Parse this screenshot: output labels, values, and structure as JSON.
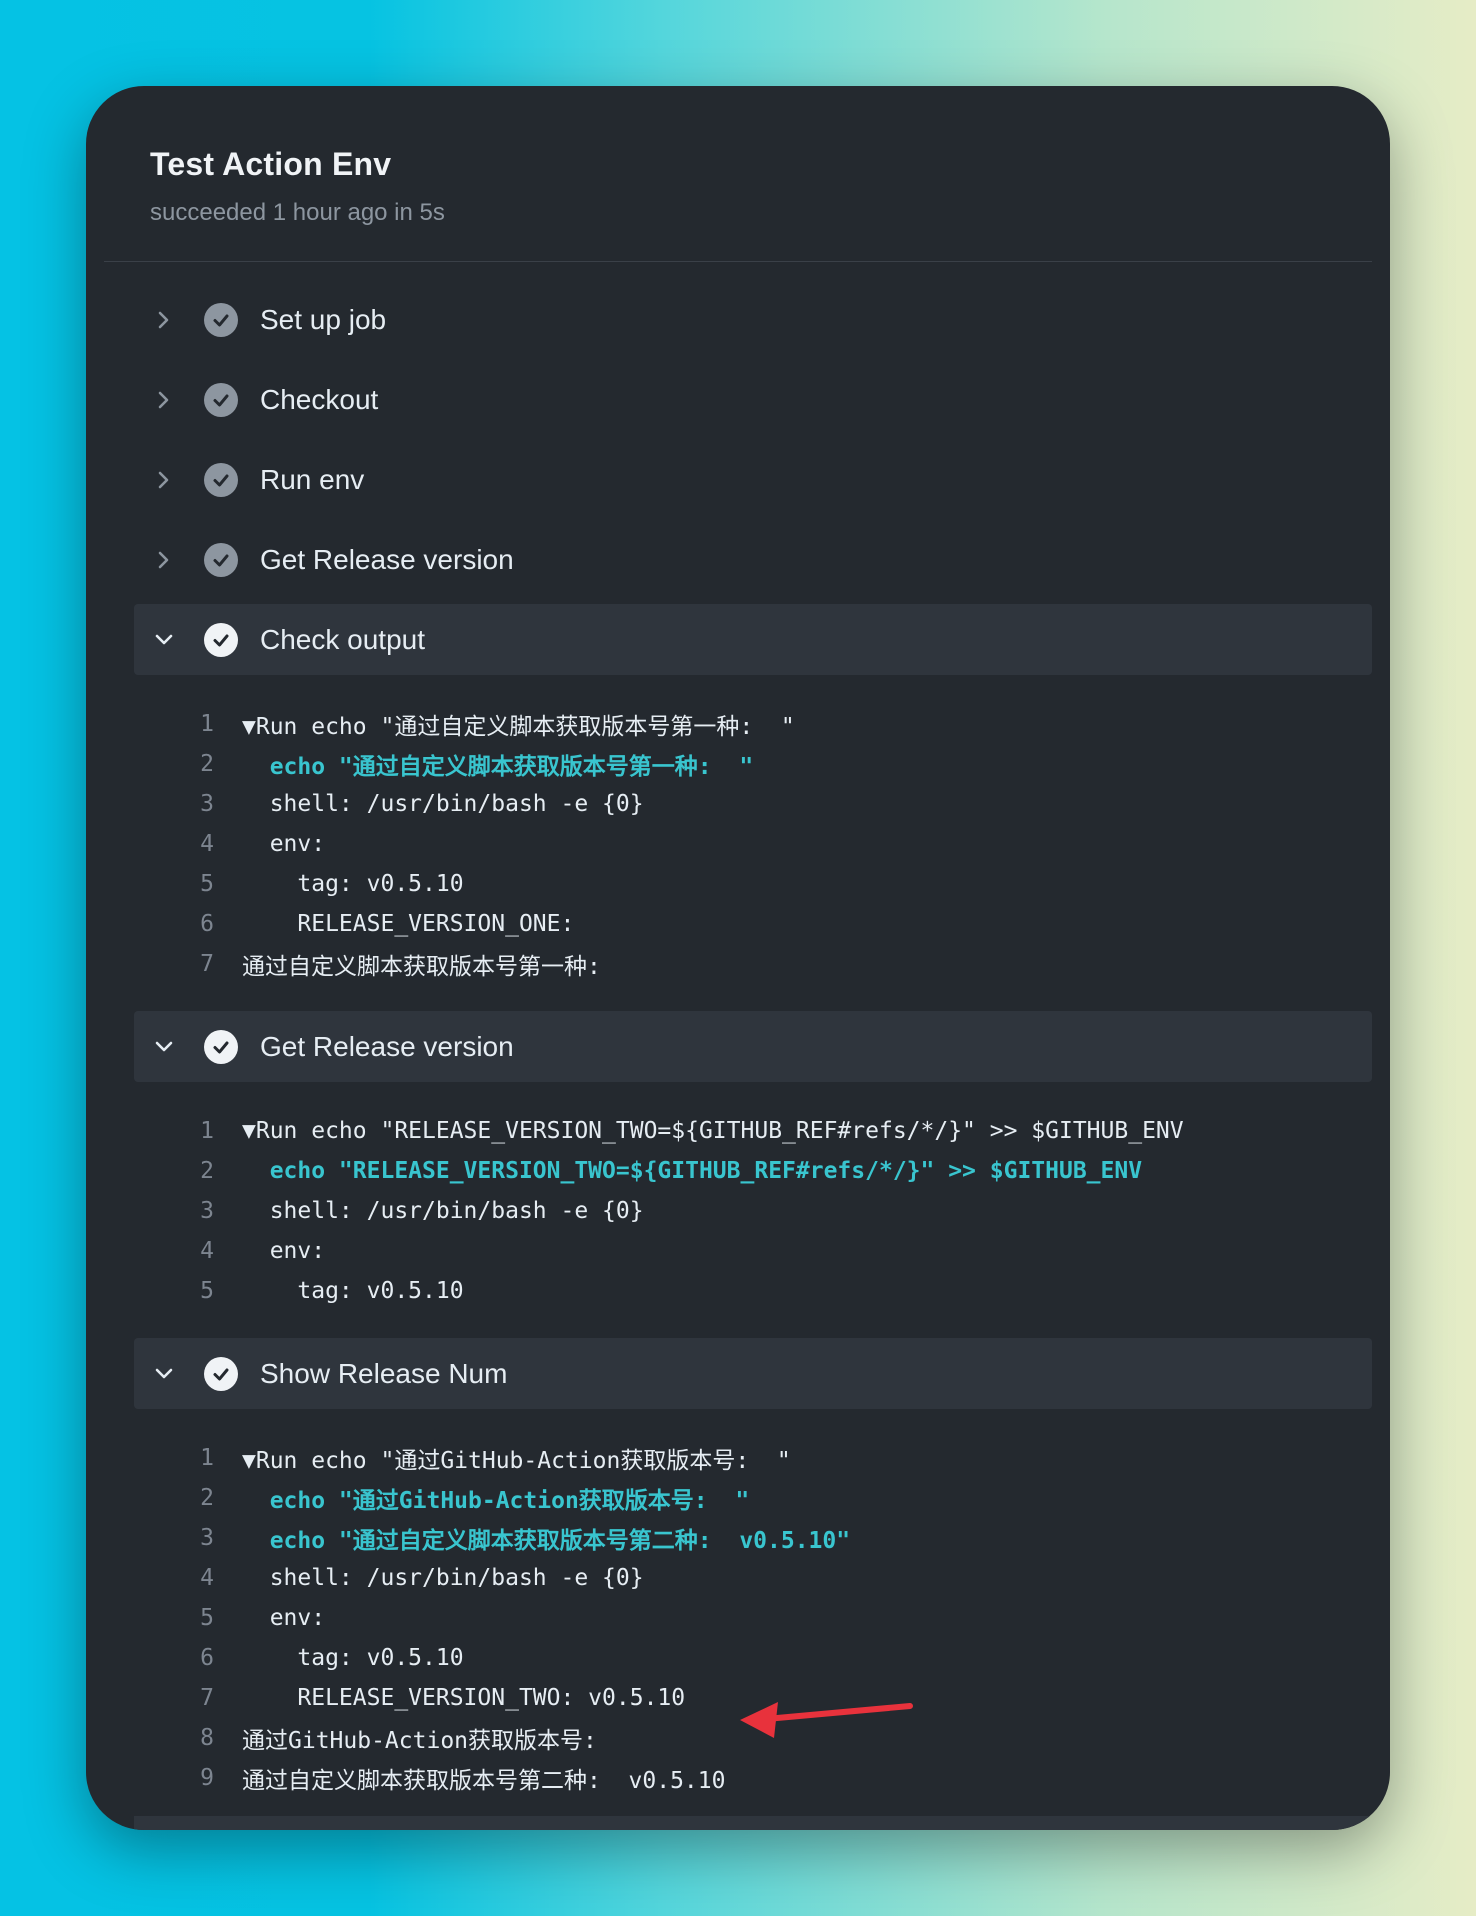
{
  "job": {
    "title": "Test Action Env",
    "status": "succeeded 1 hour ago in 5s"
  },
  "steps": [
    {
      "label": "Set up job",
      "expanded": false
    },
    {
      "label": "Checkout",
      "expanded": false
    },
    {
      "label": "Run env",
      "expanded": false
    },
    {
      "label": "Get Release version",
      "expanded": false
    },
    {
      "label": "Check output",
      "expanded": true,
      "lines": [
        {
          "n": "1",
          "text": "▼Run echo \"通过自定义脚本获取版本号第一种:  \"",
          "cmd": false
        },
        {
          "n": "2",
          "text": "  echo \"通过自定义脚本获取版本号第一种:  \"",
          "cmd": true
        },
        {
          "n": "3",
          "text": "  shell: /usr/bin/bash -e {0}",
          "cmd": false
        },
        {
          "n": "4",
          "text": "  env:",
          "cmd": false
        },
        {
          "n": "5",
          "text": "    tag: v0.5.10",
          "cmd": false
        },
        {
          "n": "6",
          "text": "    RELEASE_VERSION_ONE:",
          "cmd": false
        },
        {
          "n": "7",
          "text": "通过自定义脚本获取版本号第一种:",
          "cmd": false
        }
      ]
    },
    {
      "label": "Get Release version",
      "expanded": true,
      "lines": [
        {
          "n": "1",
          "text": "▼Run echo \"RELEASE_VERSION_TWO=${GITHUB_REF#refs/*/}\" >> $GITHUB_ENV",
          "cmd": false
        },
        {
          "n": "2",
          "text": "  echo \"RELEASE_VERSION_TWO=${GITHUB_REF#refs/*/}\" >> $GITHUB_ENV",
          "cmd": true
        },
        {
          "n": "3",
          "text": "  shell: /usr/bin/bash -e {0}",
          "cmd": false
        },
        {
          "n": "4",
          "text": "  env:",
          "cmd": false
        },
        {
          "n": "5",
          "text": "    tag: v0.5.10",
          "cmd": false
        }
      ]
    },
    {
      "label": "Show Release Num",
      "expanded": true,
      "lines": [
        {
          "n": "1",
          "text": "▼Run echo \"通过GitHub-Action获取版本号:  \"",
          "cmd": false
        },
        {
          "n": "2",
          "text": "  echo \"通过GitHub-Action获取版本号:  \"",
          "cmd": true
        },
        {
          "n": "3",
          "text": "  echo \"通过自定义脚本获取版本号第二种:  v0.5.10\"",
          "cmd": true
        },
        {
          "n": "4",
          "text": "  shell: /usr/bin/bash -e {0}",
          "cmd": false
        },
        {
          "n": "5",
          "text": "  env:",
          "cmd": false
        },
        {
          "n": "6",
          "text": "    tag: v0.5.10",
          "cmd": false
        },
        {
          "n": "7",
          "text": "    RELEASE_VERSION_TWO: v0.5.10",
          "cmd": false
        },
        {
          "n": "8",
          "text": "通过GitHub-Action获取版本号:",
          "cmd": false
        },
        {
          "n": "9",
          "text": "通过自定义脚本获取版本号第二种:  v0.5.10",
          "cmd": false
        }
      ]
    }
  ],
  "colors": {
    "background_gradient_start": "#05c2e4",
    "background_gradient_end": "#e6ecc6",
    "card": "#24292f",
    "command_text": "#39c5cf",
    "annotation_arrow": "#e8323c"
  },
  "icons": {
    "collapsed": "chevron-right-icon",
    "expanded": "chevron-down-icon",
    "status": "check-circle-icon",
    "annotation": "red-arrow-icon"
  }
}
